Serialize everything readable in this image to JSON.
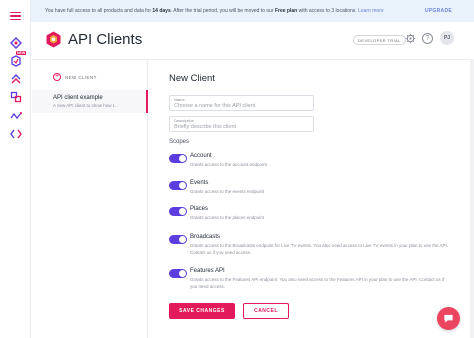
{
  "colors": {
    "accent": "#e2195b",
    "toggle_on": "#5b3de0",
    "banner_bg": "#e9f1fb",
    "link": "#6a85d8"
  },
  "banner": {
    "text_a": "You have full access to all products and data for ",
    "trial_days": "14 days",
    "text_b": ". After the trial period, you will be moved to our ",
    "plan": "Free plan",
    "text_c": " with access to 3 locations. ",
    "learn_more": "Learn more",
    "upgrade_label": "UPGRADE"
  },
  "rail": {
    "icons": [
      "menu-icon",
      "diamond-icon",
      "new-feature-icon",
      "up-chevrons-icon",
      "link-icon",
      "wave-icon",
      "code-icon"
    ],
    "new_tag": "NEW"
  },
  "header": {
    "title": "API Clients",
    "badge": "DEVELOPER TRIAL",
    "help_glyph": "?",
    "avatar_initials": "PJ"
  },
  "list": {
    "new_client_label": "NEW CLIENT",
    "items": [
      {
        "name": "API client example",
        "description": "A new API client to show how t..."
      }
    ]
  },
  "form": {
    "heading": "New Client",
    "name_label": "Name",
    "name_placeholder": "Choose a name for this API client",
    "description_label": "Description",
    "description_placeholder": "Briefly describe this client",
    "scopes_heading": "Scopes",
    "scopes": [
      {
        "title": "Account",
        "description": "Grants access to the account endpoint",
        "enabled": true
      },
      {
        "title": "Events",
        "description": "Grants access to the events endpoint",
        "enabled": true
      },
      {
        "title": "Places",
        "description": "Grants access to the places endpoint",
        "enabled": true
      },
      {
        "title": "Broadcasts",
        "description": "Grants access to the Broadcasts endpoint for Live TV events. You also need access to Live TV events in your plan to use the API. Contact us if you need access.",
        "enabled": true
      },
      {
        "title": "Features API",
        "description": "Grants access to the Features API endpoint. You also need access to the Features API in your plan to use the API. Contact us if you need access.",
        "enabled": true
      }
    ],
    "save_label": "SAVE CHANGES",
    "cancel_label": "CANCEL"
  }
}
